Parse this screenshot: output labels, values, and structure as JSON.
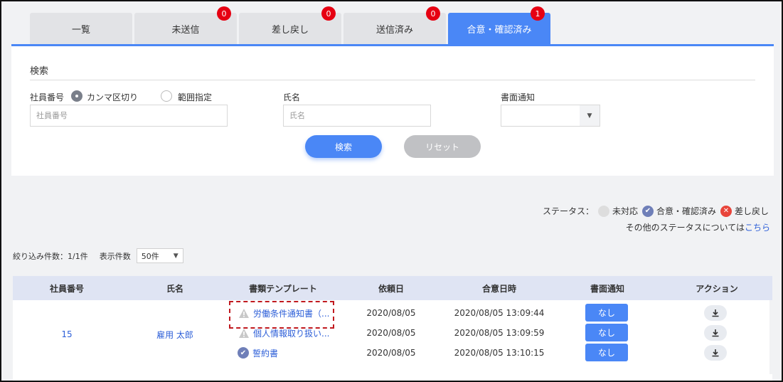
{
  "tabs": [
    {
      "label": "一覧",
      "badge": null,
      "active": false
    },
    {
      "label": "未送信",
      "badge": "0",
      "active": false
    },
    {
      "label": "差し戻し",
      "badge": "0",
      "active": false
    },
    {
      "label": "送信済み",
      "badge": "0",
      "active": false
    },
    {
      "label": "合意・確認済み",
      "badge": "1",
      "active": true
    }
  ],
  "search": {
    "title": "検索",
    "employee_no_label": "社員番号",
    "radio_comma": "カンマ区切り",
    "radio_range": "範囲指定",
    "employee_no_placeholder": "社員番号",
    "name_label": "氏名",
    "name_placeholder": "氏名",
    "notice_label": "書面通知",
    "notice_value": "",
    "search_button": "検索",
    "reset_button": "リセット"
  },
  "legend": {
    "label": "ステータス：",
    "unhandled": "未対応",
    "agreed": "合意・確認済み",
    "returned": "差し戻し",
    "other_text": "その他のステータスについては",
    "other_link": "こちら"
  },
  "list": {
    "count_text": "絞り込み件数：1/1件",
    "perpage_label": "表示件数",
    "perpage_value": "50件"
  },
  "table": {
    "headers": [
      "社員番号",
      "氏名",
      "書類テンプレート",
      "依頼日",
      "合意日時",
      "書面通知",
      "アクション"
    ],
    "employee_no": "15",
    "name": "雇用 太郎",
    "rows": [
      {
        "template": "労働条件通知書（...",
        "status": "warning",
        "request_date": "2020/08/05",
        "agreed_at": "2020/08/05 13:09:44",
        "notice": "なし"
      },
      {
        "template": "個人情報取り扱い...",
        "status": "warning",
        "request_date": "2020/08/05",
        "agreed_at": "2020/08/05 13:09:59",
        "notice": "なし"
      },
      {
        "template": "誓約書",
        "status": "agreed",
        "request_date": "2020/08/05",
        "agreed_at": "2020/08/05 13:10:15",
        "notice": "なし"
      }
    ]
  },
  "colors": {
    "accent": "#4a87f6",
    "badge": "#e60012",
    "highlight": "#c0191f"
  }
}
